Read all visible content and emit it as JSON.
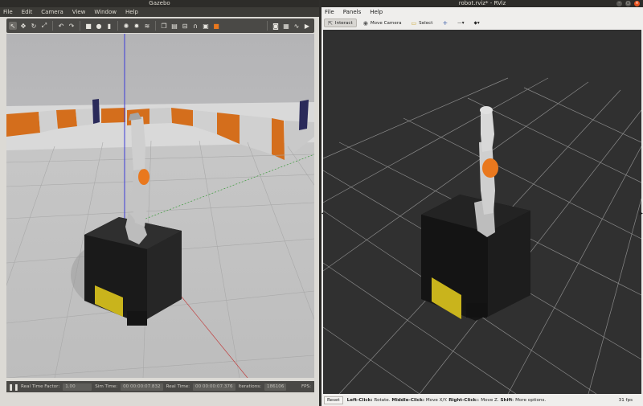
{
  "gazebo": {
    "title": "Gazebo",
    "menu": [
      "File",
      "Edit",
      "Camera",
      "View",
      "Window",
      "Help"
    ],
    "toolbar_icons": [
      "select-arrow-icon",
      "translate-icon",
      "rotate-icon",
      "scale-icon",
      "undo-icon",
      "redo-icon",
      "box-icon",
      "sphere-icon",
      "cylinder-icon",
      "point-light-icon",
      "spot-light-icon",
      "directional-light-icon",
      "copy-icon",
      "paste-icon",
      "align-icon",
      "snap-icon",
      "change-view-icon",
      "color-icon",
      "screenshot-icon",
      "log-icon",
      "plot-icon",
      "video-icon"
    ],
    "status": {
      "pause_icon": "pause-icon",
      "rtf_label": "Real Time Factor:",
      "rtf_value": "1.00",
      "sim_time_label": "Sim Time:",
      "sim_time_value": "00 00:00:07.832",
      "real_time_label": "Real Time:",
      "real_time_value": "00 00:00:07.376",
      "iterations_label": "Iterations:",
      "iterations_value": "186106",
      "fps_label": "FPS:"
    }
  },
  "rviz": {
    "title": "robot.rviz* - RViz",
    "menu": [
      "File",
      "Panels",
      "Help"
    ],
    "tools": [
      {
        "label": "Interact",
        "icon": "interact-icon",
        "active": true
      },
      {
        "label": "Move Camera",
        "icon": "move-camera-icon",
        "active": false
      },
      {
        "label": "Select",
        "icon": "select-icon",
        "active": false
      }
    ],
    "extra_tools": [
      "+",
      "—▾",
      "◆▾"
    ],
    "status": {
      "reset_label": "Reset",
      "help_left_bold": "Left-Click:",
      "help_left": " Rotate. ",
      "help_mid_bold": "Middle-Click:",
      "help_mid": " Move X/Y. ",
      "help_right_bold": "Right-Click:",
      "help_right": ": Move Z. ",
      "help_shift_bold": "Shift",
      "help_shift": ": More options.",
      "fps": "31 fps"
    }
  },
  "colors": {
    "ubuntu_orange": "#e95420",
    "robot_orange": "#e9781e",
    "robot_yellow": "#c9b41c",
    "rviz_bg": "#303030",
    "gazebo_ground": "#bcbcbc"
  }
}
